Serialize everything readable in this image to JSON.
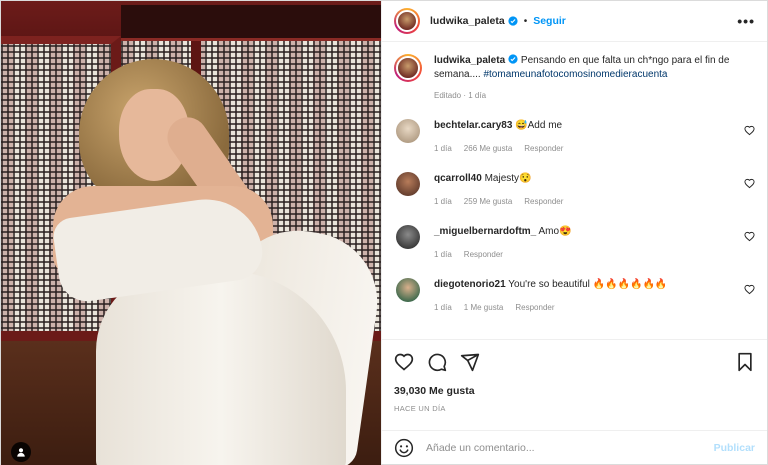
{
  "header": {
    "username": "ludwika_paleta",
    "separator": "•",
    "follow_label": "Seguir",
    "more_label": "•••"
  },
  "caption": {
    "username": "ludwika_paleta",
    "text": " Pensando en que falta un ch*ngo para el fin de semana.... ",
    "hashtag": "#tomameunafotocomosinomedieracuenta",
    "meta": "Editado · 1 día"
  },
  "comments": [
    {
      "username": "bechtelar.cary83",
      "text": " 😅Add me",
      "time": "1 día",
      "likes": "266 Me gusta",
      "reply": "Responder",
      "avatar_color": "#c9b7a0"
    },
    {
      "username": "qcarroll40",
      "text": " Majesty😯",
      "time": "1 día",
      "likes": "259 Me gusta",
      "reply": "Responder",
      "avatar_color": "#7a4a3a"
    },
    {
      "username": "_miguelbernardoftm_",
      "text": " Amo😍",
      "time": "1 día",
      "likes": "",
      "reply": "Responder",
      "avatar_color": "#3a3a3a"
    },
    {
      "username": "diegotenorio21",
      "text": " You're so beautiful 🔥🔥🔥🔥🔥🔥",
      "time": "1 día",
      "likes": "1 Me gusta",
      "reply": "Responder",
      "avatar_color": "#5b8f6a"
    }
  ],
  "footer": {
    "likes": "39,030 Me gusta",
    "ago": "HACE UN DÍA",
    "comment_placeholder": "Añade un comentario...",
    "publish_label": "Publicar"
  },
  "colors": {
    "accent": "#0095f6",
    "publish_disabled": "#b2dffc",
    "muted": "#8e8e8e",
    "text": "#262626"
  },
  "icons": [
    "verified-icon",
    "more-icon",
    "heart-icon",
    "comment-icon",
    "share-icon",
    "bookmark-icon",
    "emoji-icon",
    "user-tag-icon"
  ]
}
